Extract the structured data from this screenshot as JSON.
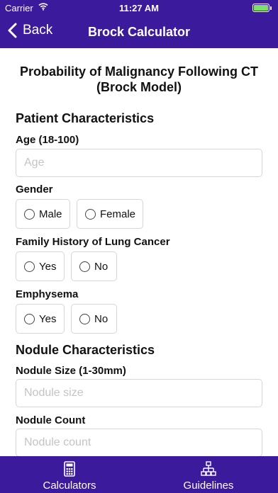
{
  "status_bar": {
    "carrier": "Carrier",
    "time": "11:27 AM",
    "battery_level": 1.0
  },
  "nav": {
    "back_label": "Back",
    "title": "Brock Calculator"
  },
  "page_title_line1": "Probability of Malignancy Following CT",
  "page_title_line2": "(Brock Model)",
  "patient_section": "Patient Characteristics",
  "age": {
    "label": "Age (18-100)",
    "placeholder": "Age",
    "value": ""
  },
  "gender": {
    "label": "Gender",
    "options": [
      "Male",
      "Female"
    ]
  },
  "family_history": {
    "label": "Family History of Lung Cancer",
    "options": [
      "Yes",
      "No"
    ]
  },
  "emphysema": {
    "label": "Emphysema",
    "options": [
      "Yes",
      "No"
    ]
  },
  "nodule_section": "Nodule Characteristics",
  "nodule_size": {
    "label": "Nodule Size (1-30mm)",
    "placeholder": "Nodule size",
    "value": ""
  },
  "nodule_count": {
    "label": "Nodule Count",
    "placeholder": "Nodule count",
    "value": ""
  },
  "tabs": [
    {
      "label": "Calculators",
      "icon": "calculator-icon"
    },
    {
      "label": "Guidelines",
      "icon": "hierarchy-icon"
    }
  ],
  "colors": {
    "brand": "#3b1a9c",
    "battery": "#7ee06b",
    "border": "#d6d6d6",
    "placeholder": "#c4c4c4"
  }
}
